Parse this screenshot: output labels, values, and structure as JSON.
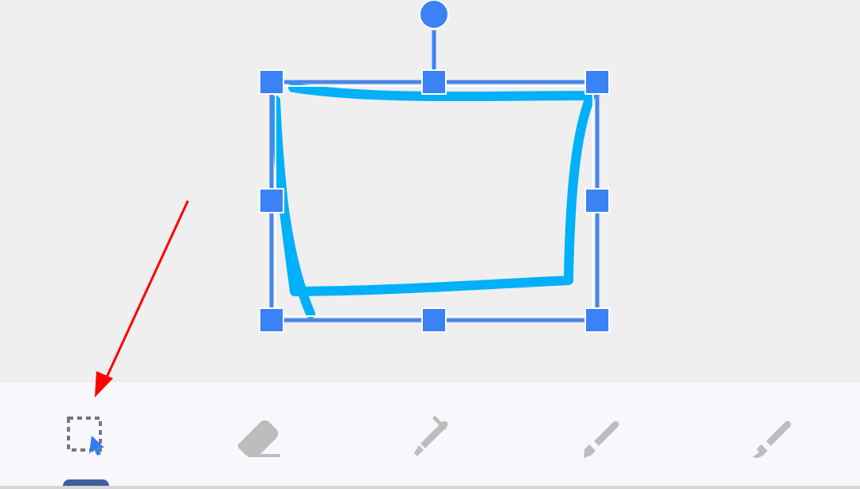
{
  "canvas": {
    "selected_stroke_color": "#00b0f8",
    "selection_color": "#3b82f6"
  },
  "toolbar": {
    "active_tool": "selection",
    "items": [
      {
        "name": "selection",
        "icon": "selection-icon",
        "active": true,
        "active_color": "#2f7cf6"
      },
      {
        "name": "eraser",
        "icon": "eraser-icon",
        "active": false
      },
      {
        "name": "pen",
        "icon": "pen-icon",
        "active": false
      },
      {
        "name": "marker",
        "icon": "marker-icon",
        "active": false
      },
      {
        "name": "highlighter",
        "icon": "highlighter-icon",
        "active": false
      }
    ],
    "inactive_color": "#bdbdbd"
  },
  "annotation": {
    "arrow_color": "#ff0000",
    "points_to": "selection-tool"
  }
}
